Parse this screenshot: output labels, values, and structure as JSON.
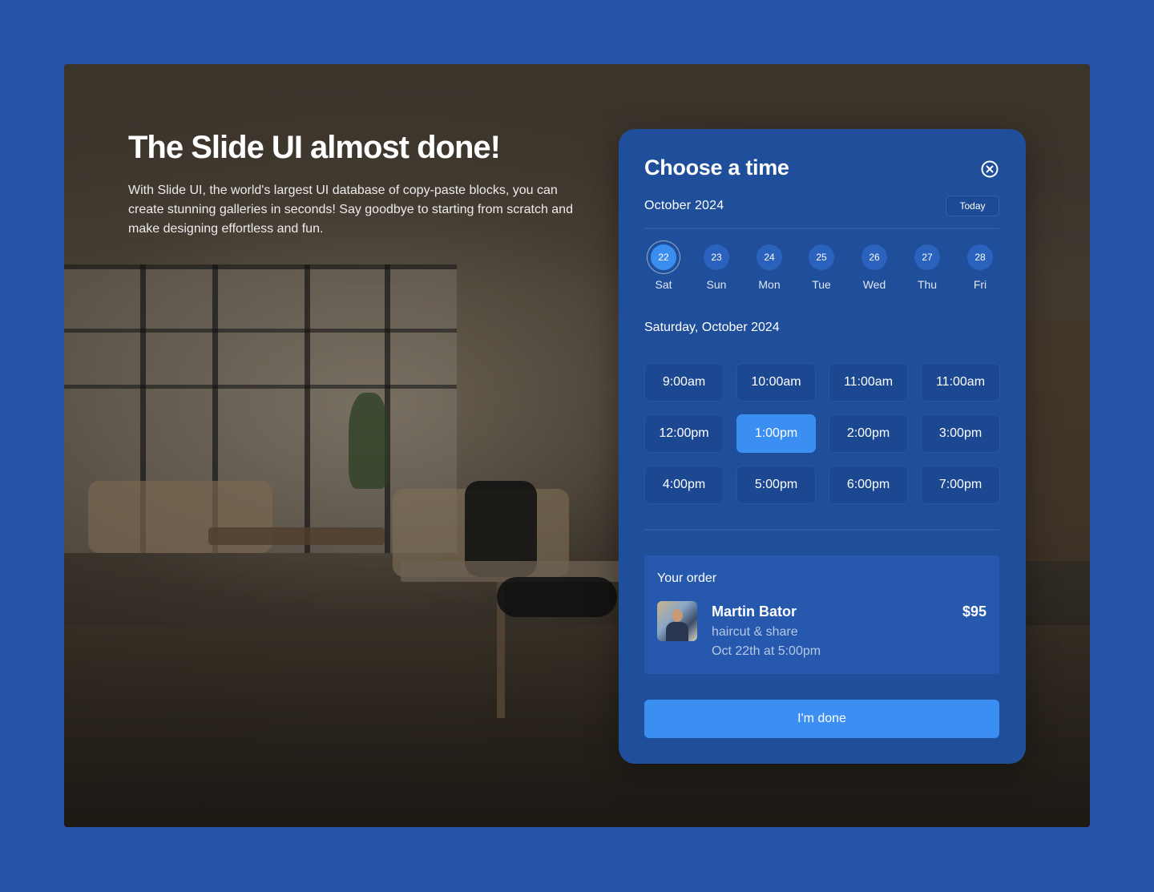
{
  "hero": {
    "headline": "The Slide UI almost done!",
    "intro": "With Slide UI, the world's largest UI database of copy-paste blocks, you can create stunning galleries in seconds! Say goodbye to starting from scratch and make designing effortless and fun."
  },
  "booking": {
    "title": "Choose a time",
    "close_icon": "close-circle-icon",
    "month": "October 2024",
    "today_label": "Today",
    "days": [
      {
        "num": "22",
        "name": "Sat",
        "selected": true
      },
      {
        "num": "23",
        "name": "Sun",
        "selected": false
      },
      {
        "num": "24",
        "name": "Mon",
        "selected": false
      },
      {
        "num": "25",
        "name": "Tue",
        "selected": false
      },
      {
        "num": "26",
        "name": "Wed",
        "selected": false
      },
      {
        "num": "27",
        "name": "Thu",
        "selected": false
      },
      {
        "num": "28",
        "name": "Fri",
        "selected": false
      }
    ],
    "date_heading": "Saturday, October 2024",
    "slots": [
      {
        "label": "9:00am",
        "selected": false
      },
      {
        "label": "10:00am",
        "selected": false
      },
      {
        "label": "11:00am",
        "selected": false
      },
      {
        "label": "11:00am",
        "selected": false
      },
      {
        "label": "12:00pm",
        "selected": false
      },
      {
        "label": "1:00pm",
        "selected": true
      },
      {
        "label": "2:00pm",
        "selected": false
      },
      {
        "label": "3:00pm",
        "selected": false
      },
      {
        "label": "4:00pm",
        "selected": false
      },
      {
        "label": "5:00pm",
        "selected": false
      },
      {
        "label": "6:00pm",
        "selected": false
      },
      {
        "label": "7:00pm",
        "selected": false
      }
    ],
    "order": {
      "label": "Your order",
      "name": "Martin Bator",
      "service": "haircut & share",
      "when": "Oct 22th at 5:00pm",
      "price": "$95"
    },
    "done_label": "I'm done"
  },
  "colors": {
    "page_bg": "#2554a8",
    "card_bg": "#1f4e9a",
    "accent": "#3b8ff2"
  }
}
